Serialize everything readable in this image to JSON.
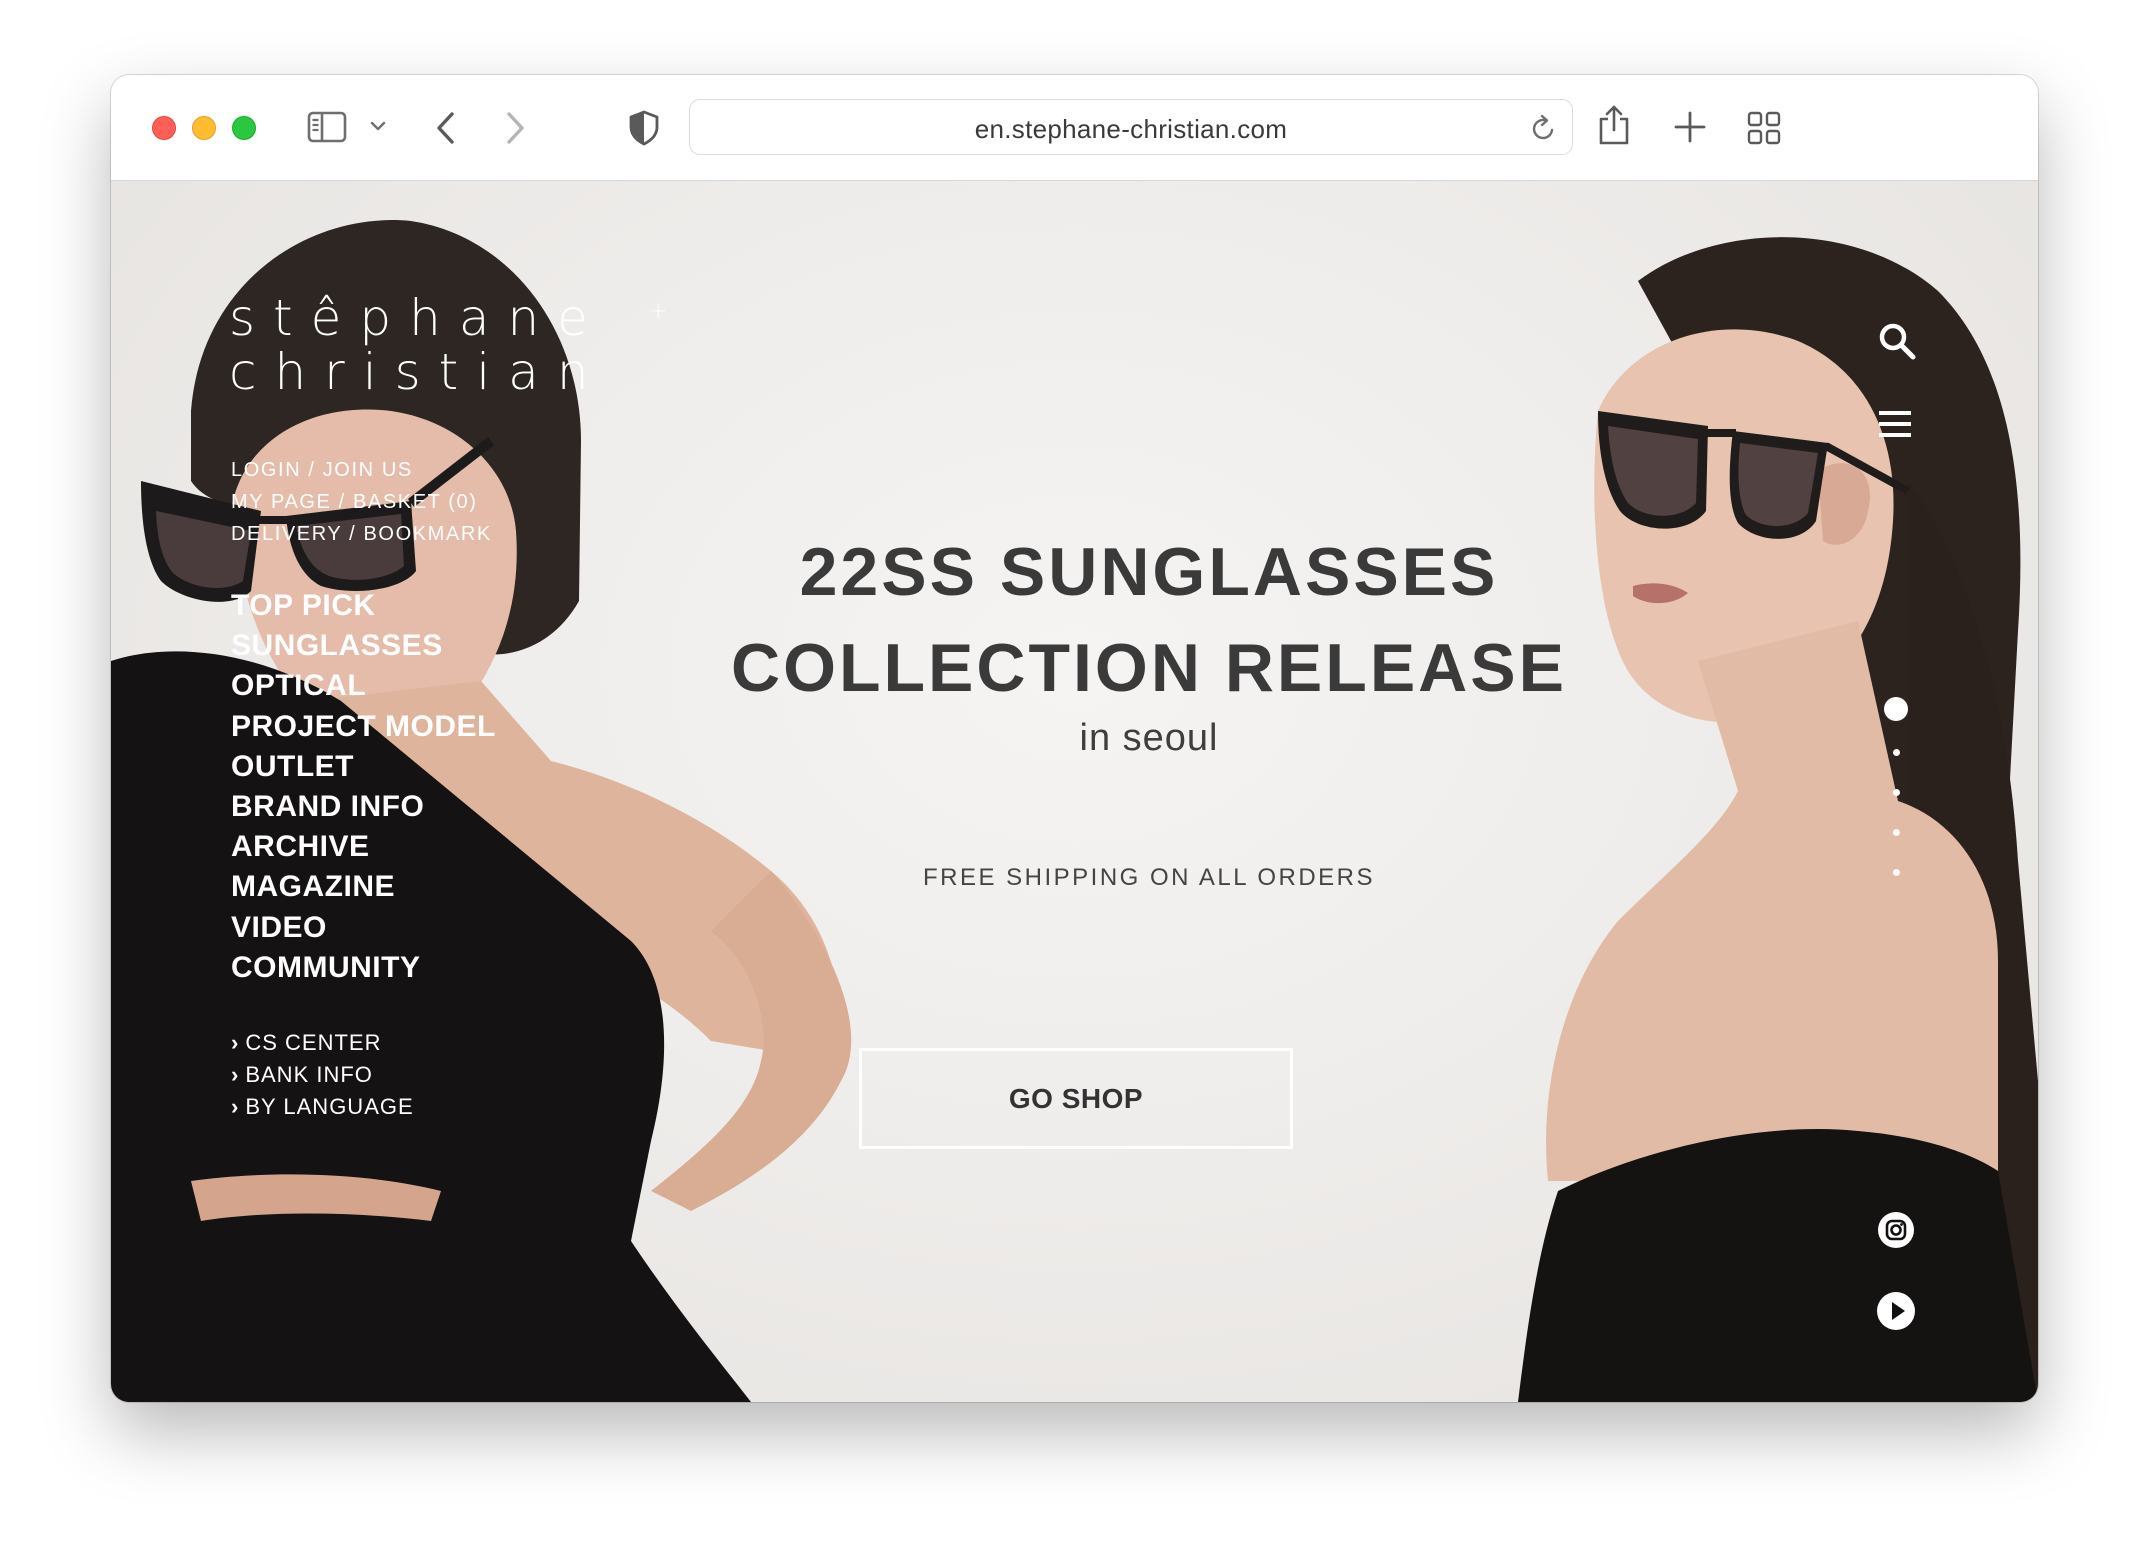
{
  "browser": {
    "url": "en.stephane-christian.com",
    "icons": [
      "sidebar-icon",
      "chevron-down-icon",
      "back-icon",
      "forward-icon",
      "shield-icon",
      "reload-icon",
      "share-icon",
      "new-tab-icon",
      "tab-overview-icon"
    ]
  },
  "brand": {
    "line1": "stêphane",
    "line2": "christian",
    "plus": "+"
  },
  "util_links": [
    "LOGIN / JOIN US",
    "MY PAGE / BASKET (0)",
    "DELIVERY / BOOKMARK"
  ],
  "main_nav": [
    "TOP PICK",
    "SUNGLASSES",
    "OPTICAL",
    "PROJECT MODEL",
    "OUTLET",
    "BRAND INFO",
    "ARCHIVE",
    "MAGAZINE",
    "VIDEO",
    "COMMUNITY"
  ],
  "sub_nav": [
    "CS CENTER",
    "BANK INFO",
    "BY LANGUAGE"
  ],
  "hero": {
    "title_line1": "22SS SUNGLASSES",
    "title_line2": "COLLECTION RELEASE",
    "subtitle": "in seoul",
    "shipping": "FREE SHIPPING ON ALL ORDERS",
    "cta": "GO SHOP"
  },
  "slider": {
    "total_slides": 5,
    "active_slide": 1
  },
  "right_icons": [
    "search-icon",
    "menu-icon",
    "instagram-icon",
    "play-icon"
  ],
  "colors": {
    "hero_text": "#3a3a3a",
    "nav_text": "#ffffff",
    "page_bg": "#eeecea"
  }
}
